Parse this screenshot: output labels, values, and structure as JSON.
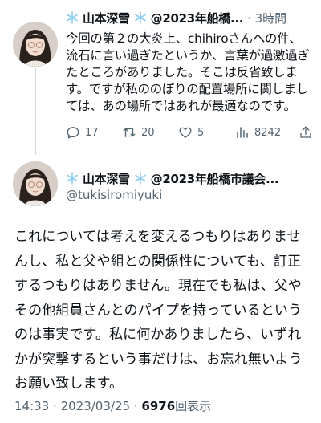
{
  "reply_tweet": {
    "display_name": "山本深雪",
    "handle_truncated": "@2023年船橋...",
    "separator": "·",
    "time": "3時間",
    "lines": [
      "今回の第２の大炎上、chihiroさんへの件、",
      "流石に言い過ぎたというか、言葉が過激過ぎ",
      "たところがありました。そこは反省致しま",
      "す。ですが私ののぼりの配置場所に関しまし",
      "ては、あの場所ではあれが最適なのです。"
    ],
    "actions": {
      "replies": "17",
      "retweets": "20",
      "likes": "5",
      "views": "8242"
    }
  },
  "main_tweet": {
    "display_name": "山本深雪",
    "account_label": "@2023年船橋市議会...",
    "handle": "@tukisiromiyuki",
    "lines": [
      "これについては考えを変えるつもりはありませ",
      "んし、私と父や組との関係性についても、訂正",
      "するつもりはありません。現在でも私は、父や",
      "その他組員さんとのパイプを持っているという",
      "のは事実です。私に何かありましたら、いずれ",
      "かが突撃するという事だけは、お忘れ無いよう",
      "お願い致します。"
    ],
    "meta": {
      "time": "14:33",
      "sep1": "·",
      "date": "2023/03/25",
      "sep2": "·",
      "views_count": "6976",
      "views_label": "回表示"
    }
  },
  "colors": {
    "text": "#0f1419",
    "secondary": "#536471",
    "snowflake": "#8ecdf2",
    "thread_line": "#cfd9de"
  },
  "icons": [
    "snowflake-icon",
    "reply-icon",
    "retweet-icon",
    "like-icon",
    "views-icon"
  ]
}
